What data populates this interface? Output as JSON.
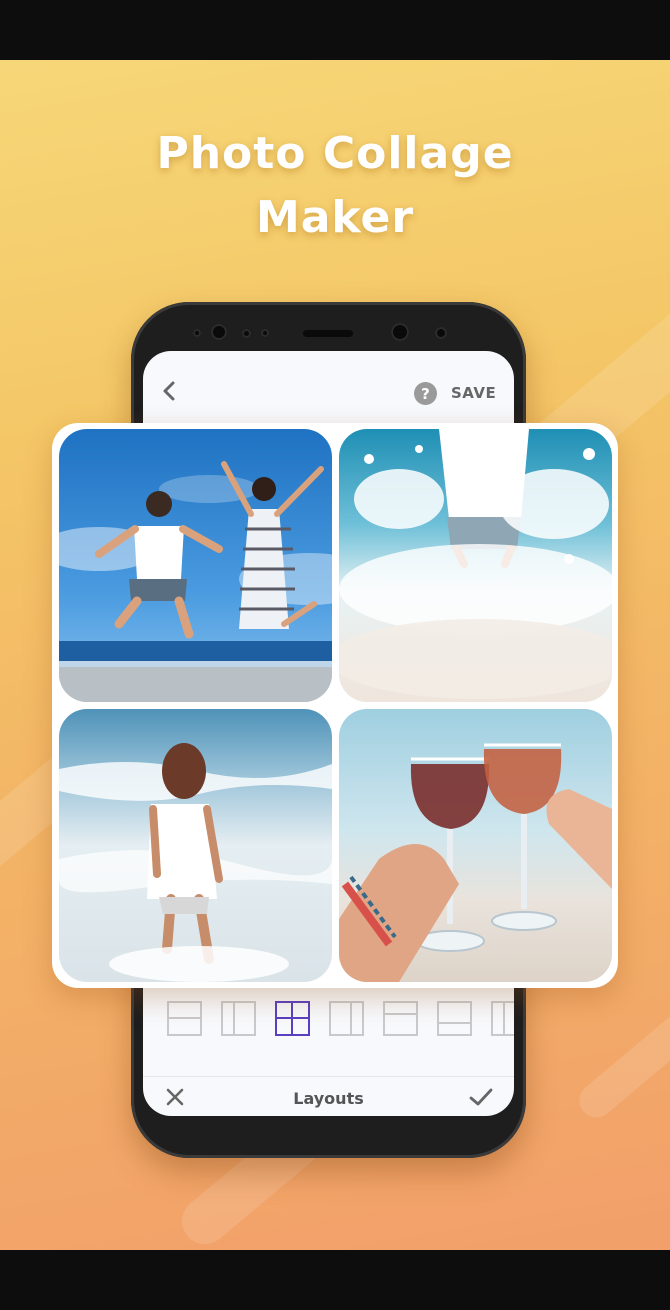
{
  "headline": {
    "line1": "Photo Collage",
    "line2": "Maker"
  },
  "toolbar": {
    "back_icon": "chevron-left-icon",
    "help_symbol": "?",
    "save_label": "SAVE"
  },
  "collage": {
    "layout": "2x2 grid",
    "photos": [
      "couple-jumping-on-beach",
      "person-splashing-in-waves",
      "woman-walking-into-sea",
      "toasting-wine-glasses"
    ]
  },
  "layout_options": {
    "selected_index": 2,
    "count": 7
  },
  "bottom_bar": {
    "cancel_icon": "close-icon",
    "title": "Layouts",
    "confirm_icon": "check-icon"
  },
  "colors": {
    "accent": "#5a3fc0",
    "background_top": "#f6d778",
    "background_bottom": "#f29f6a"
  }
}
